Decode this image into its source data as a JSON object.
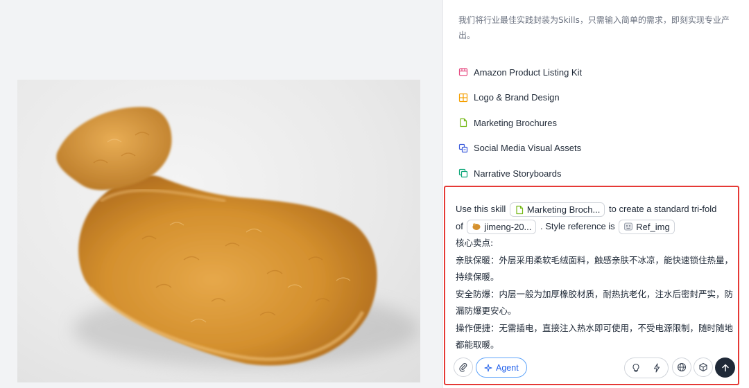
{
  "canvas": {
    "image_alt": "Plush hot water bottle"
  },
  "panel": {
    "intro": "我们将行业最佳实践封装为Skills，只需输入简单的需求，即刻实现专业产出。",
    "skills": [
      {
        "label": "Amazon Product Listing Kit",
        "icon": "store-icon",
        "color": "#e64980"
      },
      {
        "label": "Logo & Brand Design",
        "icon": "layout-icon",
        "color": "#f59f00"
      },
      {
        "label": "Marketing Brochures",
        "icon": "document-icon",
        "color": "#74b816"
      },
      {
        "label": "Social Media Visual Assets",
        "icon": "share-icon",
        "color": "#3b5bdb"
      },
      {
        "label": "Narrative Storyboards",
        "icon": "copy-icon",
        "color": "#0ca678"
      }
    ]
  },
  "composer": {
    "prefix": "Use this skill",
    "skill_chip": "Marketing Broch...",
    "middle": "to create a standard tri-fold",
    "of_text": "of",
    "file_chip": "jimeng-20...",
    "style_text": ". Style reference is",
    "ref_chip": "Ref_img",
    "lines": [
      "核心卖点:",
      "亲肤保暖：外层采用柔软毛绒面料，触感亲肤不冰凉，能快速锁住热量，持续保暖。",
      "安全防爆：内层一般为加厚橡胶材质，耐热抗老化，注水后密封严实，防漏防爆更安心。",
      "操作便捷：无需插电，直接注入热水即可使用，不受电源限制，随时随地都能取暖。"
    ],
    "agent_label": "Agent"
  },
  "colors": {
    "highlight_border": "#e53935",
    "agent_accent": "#2563eb",
    "send_button": "#1f2937"
  }
}
